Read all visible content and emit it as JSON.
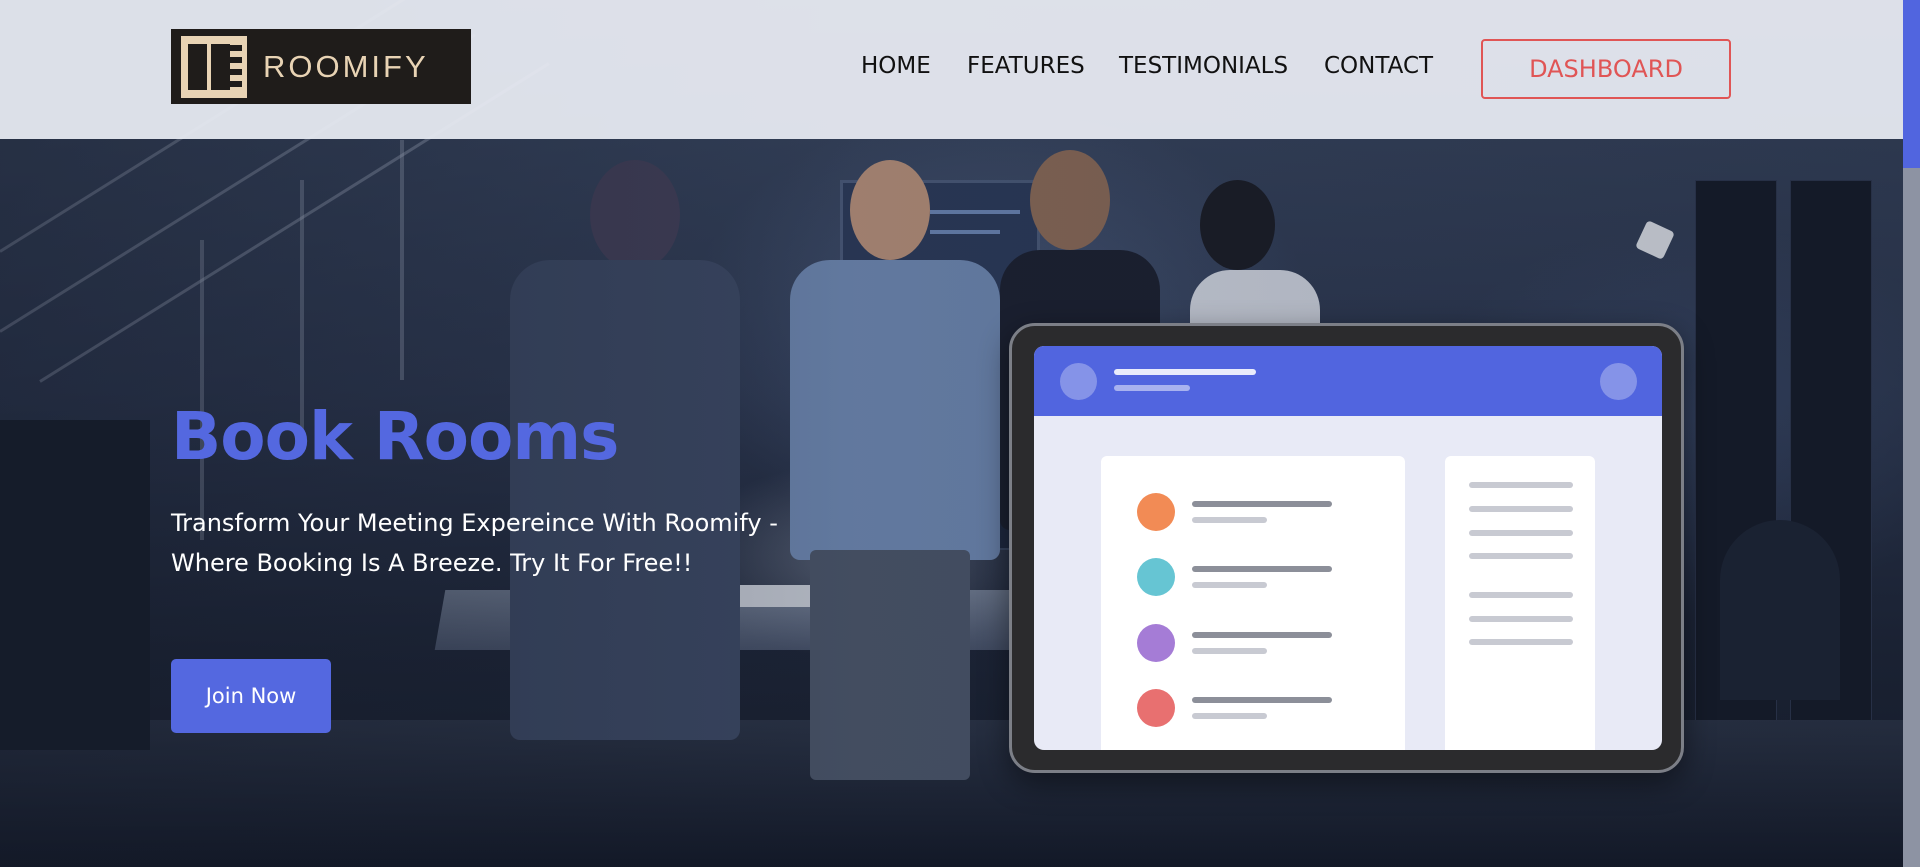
{
  "header": {
    "logo_text": "ROOMIFY",
    "nav": [
      {
        "label": "HOME",
        "id": "home"
      },
      {
        "label": "FEATURES",
        "id": "features"
      },
      {
        "label": "TESTIMONIALS",
        "id": "testimonials"
      },
      {
        "label": "CONTACT",
        "id": "contact"
      }
    ],
    "dashboard_label": "DASHBOARD"
  },
  "hero": {
    "title": "Book Rooms",
    "subtitle": "Transform Your Meeting Expereince With Roomify - Where Booking Is A Breeze. Try It For Free!!",
    "cta_label": "Join Now"
  },
  "colors": {
    "accent": "#5468e0",
    "dashboard_border": "#e05555",
    "header_bg": "#e8ebf2",
    "logo_bg": "#1f1c1a",
    "logo_fg": "#e8d3b4",
    "mockup_dots": [
      "#f28b55",
      "#66c5d3",
      "#a57cd6",
      "#e87070"
    ]
  },
  "icons": {
    "logo": "wardrobe-logo-icon"
  }
}
